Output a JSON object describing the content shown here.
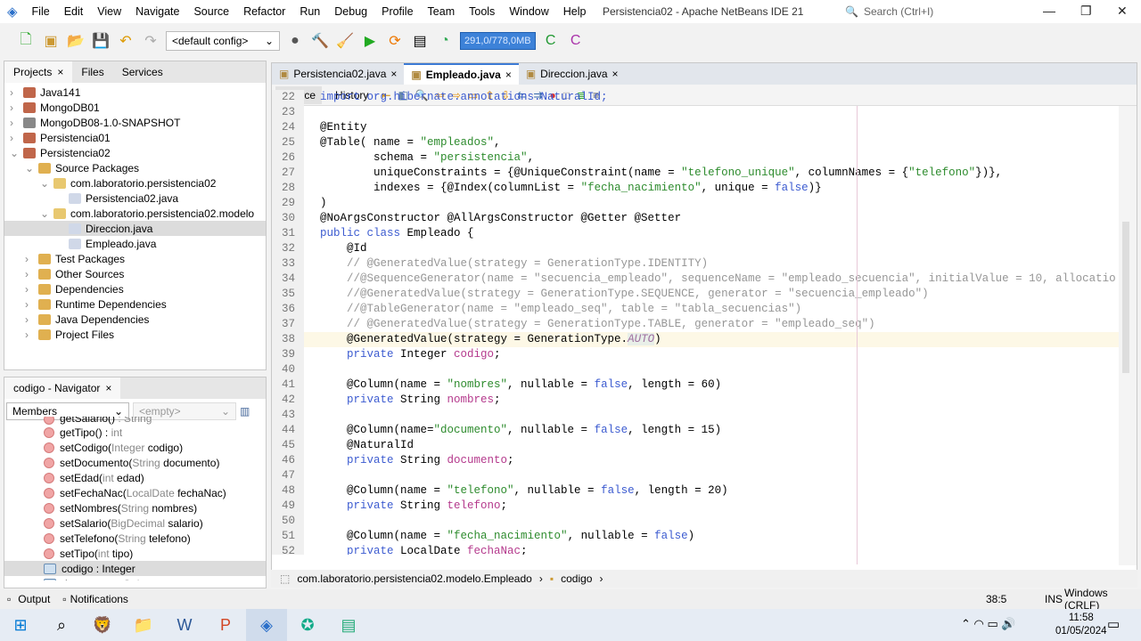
{
  "menu": [
    "File",
    "Edit",
    "View",
    "Navigate",
    "Source",
    "Refactor",
    "Run",
    "Debug",
    "Profile",
    "Team",
    "Tools",
    "Window",
    "Help"
  ],
  "window_title": "Persistencia02 - Apache NetBeans IDE 21",
  "search_placeholder": "Search (Ctrl+I)",
  "toolbar": {
    "config": "<default config>",
    "memory": "291,0/778,0MB"
  },
  "projects_panel": {
    "tabs": [
      "Projects",
      "Files",
      "Services"
    ],
    "items": [
      {
        "label": "Java141",
        "indent": 0,
        "exp": ">",
        "icon": "#c0664a"
      },
      {
        "label": "MongoDB01",
        "indent": 0,
        "exp": ">",
        "icon": "#c0664a"
      },
      {
        "label": "MongoDB08-1.0-SNAPSHOT",
        "indent": 0,
        "exp": ">",
        "icon": "#888"
      },
      {
        "label": "Persistencia01",
        "indent": 0,
        "exp": ">",
        "icon": "#c0664a"
      },
      {
        "label": "Persistencia02",
        "indent": 0,
        "exp": "v",
        "icon": "#c0664a"
      },
      {
        "label": "Source Packages",
        "indent": 1,
        "exp": "v",
        "icon": "#e0b050"
      },
      {
        "label": "com.laboratorio.persistencia02",
        "indent": 2,
        "exp": "v",
        "icon": "#e8c870"
      },
      {
        "label": "Persistencia02.java",
        "indent": 3,
        "exp": "",
        "icon": "#d0d8e8"
      },
      {
        "label": "com.laboratorio.persistencia02.modelo",
        "indent": 2,
        "exp": "v",
        "icon": "#e8c870"
      },
      {
        "label": "Direccion.java",
        "indent": 3,
        "exp": "",
        "icon": "#d0d8e8",
        "selected": true
      },
      {
        "label": "Empleado.java",
        "indent": 3,
        "exp": "",
        "icon": "#d0d8e8"
      },
      {
        "label": "Test Packages",
        "indent": 1,
        "exp": ">",
        "icon": "#e0b050"
      },
      {
        "label": "Other Sources",
        "indent": 1,
        "exp": ">",
        "icon": "#e0b050"
      },
      {
        "label": "Dependencies",
        "indent": 1,
        "exp": ">",
        "icon": "#e0b050"
      },
      {
        "label": "Runtime Dependencies",
        "indent": 1,
        "exp": ">",
        "icon": "#e0b050"
      },
      {
        "label": "Java Dependencies",
        "indent": 1,
        "exp": ">",
        "icon": "#e0b050"
      },
      {
        "label": "Project Files",
        "indent": 1,
        "exp": ">",
        "icon": "#e0b050"
      }
    ]
  },
  "navigator": {
    "title": "codigo - Navigator",
    "filter": "Members",
    "filter2": "<empty>",
    "items": [
      {
        "name": "getSalario()",
        "type": " : String",
        "cut": true
      },
      {
        "name": "getTipo() : ",
        "type": "int"
      },
      {
        "name": "setCodigo(",
        "type": "Integer",
        "rest": " codigo)"
      },
      {
        "name": "setDocumento(",
        "type": "String",
        "rest": " documento)"
      },
      {
        "name": "setEdad(",
        "type": "int",
        "rest": " edad)"
      },
      {
        "name": "setFechaNac(",
        "type": "LocalDate",
        "rest": " fechaNac)"
      },
      {
        "name": "setNombres(",
        "type": "String",
        "rest": " nombres)"
      },
      {
        "name": "setSalario(",
        "type": "BigDecimal",
        "rest": " salario)"
      },
      {
        "name": "setTelefono(",
        "type": "String",
        "rest": " telefono)"
      },
      {
        "name": "setTipo(",
        "type": "int",
        "rest": " tipo)"
      },
      {
        "name": "codigo : Integer",
        "type": "",
        "field": true,
        "selected": true
      },
      {
        "name": "documento : ",
        "type": "String",
        "field": true
      }
    ]
  },
  "editor": {
    "tabs": [
      "Persistencia02.java",
      "Empleado.java",
      "Direccion.java"
    ],
    "active_tab": 1,
    "views": [
      "Source",
      "History"
    ],
    "lines": [
      {
        "n": "22",
        "t": [
          [
            "import org.hibernate.annotations.NaturalId;",
            "kw"
          ]
        ]
      },
      {
        "n": "23",
        "t": []
      },
      {
        "n": "24",
        "t": [
          [
            "@Entity",
            ""
          ]
        ]
      },
      {
        "n": "25",
        "t": [
          [
            "@Table( name = ",
            ""
          ],
          [
            "\"empleados\"",
            "str"
          ],
          [
            ",",
            ""
          ]
        ]
      },
      {
        "n": "26",
        "t": [
          [
            "        schema = ",
            ""
          ],
          [
            "\"persistencia\"",
            "str"
          ],
          [
            ",",
            ""
          ]
        ]
      },
      {
        "n": "27",
        "t": [
          [
            "        uniqueConstraints = {@UniqueConstraint(name = ",
            ""
          ],
          [
            "\"telefono_unique\"",
            "str"
          ],
          [
            ", columnNames = {",
            ""
          ],
          [
            "\"telefono\"",
            "str"
          ],
          [
            "})},",
            ""
          ]
        ]
      },
      {
        "n": "28",
        "t": [
          [
            "        indexes = {@Index(columnList = ",
            ""
          ],
          [
            "\"fecha_nacimiento\"",
            "str"
          ],
          [
            ", unique = ",
            ""
          ],
          [
            "false",
            "kw"
          ],
          [
            ")}",
            ""
          ]
        ]
      },
      {
        "n": "29",
        "t": [
          [
            ")",
            ""
          ]
        ]
      },
      {
        "n": "30",
        "t": [
          [
            "@NoArgsConstructor @AllArgsConstructor @Getter @Setter",
            ""
          ]
        ]
      },
      {
        "n": "31",
        "t": [
          [
            "public class ",
            "kw"
          ],
          [
            "Empleado {",
            ""
          ]
        ]
      },
      {
        "n": "32",
        "t": [
          [
            "    @Id",
            ""
          ]
        ]
      },
      {
        "n": "33",
        "t": [
          [
            "    // @GeneratedValue(strategy = GenerationType.IDENTITY)",
            "cm"
          ]
        ]
      },
      {
        "n": "34",
        "t": [
          [
            "    //@SequenceGenerator(name = \"secuencia_empleado\", sequenceName = \"empleado_secuencia\", initialValue = 10, allocatio",
            "cm"
          ]
        ]
      },
      {
        "n": "35",
        "t": [
          [
            "    //@GeneratedValue(strategy = GenerationType.SEQUENCE, generator = \"secuencia_empleado\")",
            "cm"
          ]
        ]
      },
      {
        "n": "36",
        "t": [
          [
            "    //@TableGenerator(name = \"empleado_seq\", table = \"tabla_secuencias\")",
            "cm"
          ]
        ]
      },
      {
        "n": "37",
        "t": [
          [
            "    // @GeneratedValue(strategy = GenerationType.TABLE, generator = \"empleado_seq\")",
            "cm"
          ]
        ]
      },
      {
        "n": "38",
        "cur": true,
        "t": [
          [
            "    @GeneratedValue(strategy = GenerationType.",
            ""
          ],
          [
            "AUTO",
            "enum"
          ],
          [
            ")",
            ""
          ]
        ]
      },
      {
        "n": "39",
        "t": [
          [
            "    private ",
            "kw"
          ],
          [
            "Integer ",
            ""
          ],
          [
            "codigo",
            "fld"
          ],
          [
            ";",
            ""
          ]
        ]
      },
      {
        "n": "40",
        "t": []
      },
      {
        "n": "41",
        "t": [
          [
            "    @Column(name = ",
            ""
          ],
          [
            "\"nombres\"",
            "str"
          ],
          [
            ", nullable = ",
            ""
          ],
          [
            "false",
            "kw"
          ],
          [
            ", length = 60)",
            ""
          ]
        ]
      },
      {
        "n": "42",
        "t": [
          [
            "    private ",
            "kw"
          ],
          [
            "String ",
            ""
          ],
          [
            "nombres",
            "fld"
          ],
          [
            ";",
            ""
          ]
        ]
      },
      {
        "n": "43",
        "t": []
      },
      {
        "n": "44",
        "t": [
          [
            "    @Column(name=",
            ""
          ],
          [
            "\"documento\"",
            "str"
          ],
          [
            ", nullable = ",
            ""
          ],
          [
            "false",
            "kw"
          ],
          [
            ", length = 15)",
            ""
          ]
        ]
      },
      {
        "n": "45",
        "t": [
          [
            "    @NaturalId",
            ""
          ]
        ]
      },
      {
        "n": "46",
        "t": [
          [
            "    private ",
            "kw"
          ],
          [
            "String ",
            ""
          ],
          [
            "documento",
            "fld"
          ],
          [
            ";",
            ""
          ]
        ]
      },
      {
        "n": "47",
        "t": []
      },
      {
        "n": "48",
        "t": [
          [
            "    @Column(name = ",
            ""
          ],
          [
            "\"telefono\"",
            "str"
          ],
          [
            ", nullable = ",
            ""
          ],
          [
            "false",
            "kw"
          ],
          [
            ", length = 20)",
            ""
          ]
        ]
      },
      {
        "n": "49",
        "t": [
          [
            "    private ",
            "kw"
          ],
          [
            "String ",
            ""
          ],
          [
            "telefono",
            "fld"
          ],
          [
            ";",
            ""
          ]
        ]
      },
      {
        "n": "50",
        "t": []
      },
      {
        "n": "51",
        "t": [
          [
            "    @Column(name = ",
            ""
          ],
          [
            "\"fecha_nacimiento\"",
            "str"
          ],
          [
            ", nullable = ",
            ""
          ],
          [
            "false",
            "kw"
          ],
          [
            ")",
            ""
          ]
        ]
      },
      {
        "n": "52",
        "t": [
          [
            "    private ",
            "kw"
          ],
          [
            "LocalDate ",
            ""
          ],
          [
            "fechaNac",
            "fld"
          ],
          [
            ";",
            ""
          ]
        ]
      }
    ]
  },
  "breadcrumb": [
    "com.laboratorio.persistencia02.modelo.Empleado",
    "codigo"
  ],
  "status": {
    "output": "Output",
    "notifications": "Notifications",
    "position": "38:5",
    "mode": "INS",
    "line_endings": "Windows (CRLF)"
  },
  "taskbar": {
    "time": "11:58",
    "date": "01/05/2024"
  }
}
